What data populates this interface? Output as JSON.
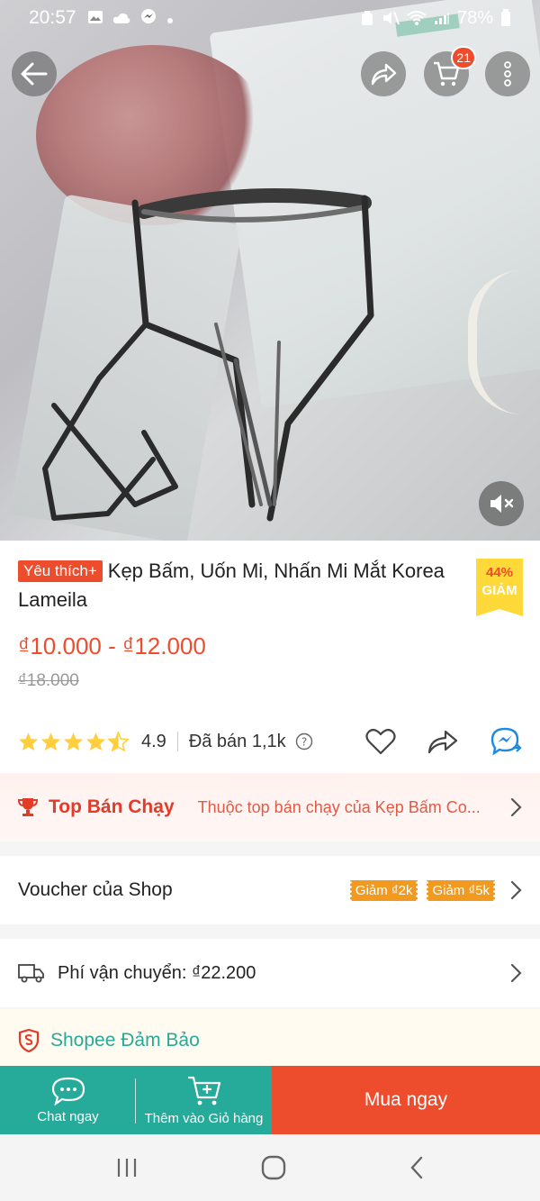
{
  "status_bar": {
    "time": "20:57",
    "battery": "78%"
  },
  "header": {
    "cart_count": "21"
  },
  "product": {
    "badge": "Yêu thích+",
    "title": "Kẹp Bấm, Uốn Mi, Nhấn Mi Mắt Korea Lameila",
    "discount_percent": "44%",
    "discount_label": "GIẢM",
    "price_range": "₫10.000 - ₫12.000",
    "original_price": "₫18.000",
    "rating": "4.9",
    "rating_stars": 4.5,
    "sold": "Đã bán 1,1k"
  },
  "top_seller": {
    "title": "Top Bán Chạy",
    "description": "Thuộc top bán chạy của Kẹp Bấm Co..."
  },
  "voucher": {
    "label": "Voucher của Shop",
    "tags": [
      "Giảm ₫2k",
      "Giảm ₫5k"
    ]
  },
  "shipping": {
    "label": "Phí vận chuyển: ₫22.200"
  },
  "guarantee": {
    "label": "Shopee Đảm Bảo"
  },
  "action_bar": {
    "chat_label": "Chat ngay",
    "add_to_cart_label": "Thêm vào Giỏ hàng",
    "buy_now_label": "Mua ngay"
  },
  "colors": {
    "brand_orange": "#ee4d2d",
    "teal": "#26aa99",
    "discount_yellow": "#ffd839",
    "voucher_orange": "#f29a1f",
    "star": "#ffce3d"
  }
}
